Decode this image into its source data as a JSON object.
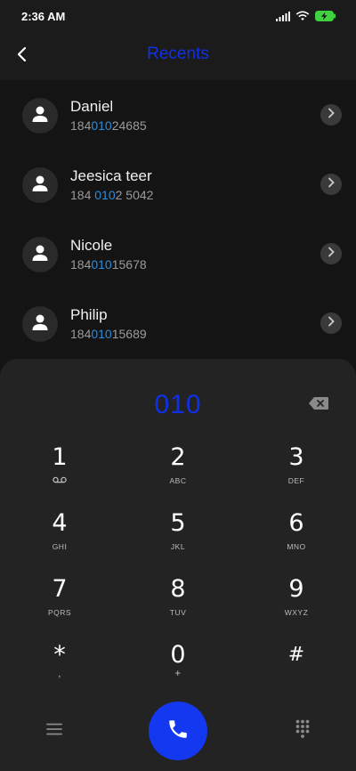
{
  "status": {
    "time": "2:36 AM"
  },
  "header": {
    "title": "Recents"
  },
  "contacts": [
    {
      "name": "Daniel",
      "number_pre": "184",
      "number_hl": "010",
      "number_post": "24685"
    },
    {
      "name": "Jeesica teer",
      "number_pre": "184 ",
      "number_hl": "010",
      "number_post": "2 5042"
    },
    {
      "name": "Nicole",
      "number_pre": "184",
      "number_hl": "010",
      "number_post": "15678"
    },
    {
      "name": "Philip",
      "number_pre": "184",
      "number_hl": "010",
      "number_post": "15689"
    }
  ],
  "dialpad": {
    "input": "010",
    "keys": [
      {
        "digit": "1",
        "letters": ""
      },
      {
        "digit": "2",
        "letters": "ABC"
      },
      {
        "digit": "3",
        "letters": "DEF"
      },
      {
        "digit": "4",
        "letters": "GHI"
      },
      {
        "digit": "5",
        "letters": "JKL"
      },
      {
        "digit": "6",
        "letters": "MNO"
      },
      {
        "digit": "7",
        "letters": "PQRS"
      },
      {
        "digit": "8",
        "letters": "TUV"
      },
      {
        "digit": "9",
        "letters": "WXYZ"
      },
      {
        "digit": "*",
        "letters": ","
      },
      {
        "digit": "0",
        "letters": "+"
      },
      {
        "digit": "#",
        "letters": ""
      }
    ]
  },
  "colors": {
    "accent": "#1030e8",
    "highlight": "#2d8bd8",
    "call_button": "#1438f0"
  },
  "icons": {
    "back": "back-arrow-icon",
    "avatar": "person-icon",
    "chevron": "chevron-right-icon",
    "backspace": "backspace-icon",
    "voicemail": "voicemail-icon",
    "menu": "menu-icon",
    "call": "phone-icon",
    "dialpad_toggle": "dialpad-grid-icon"
  }
}
